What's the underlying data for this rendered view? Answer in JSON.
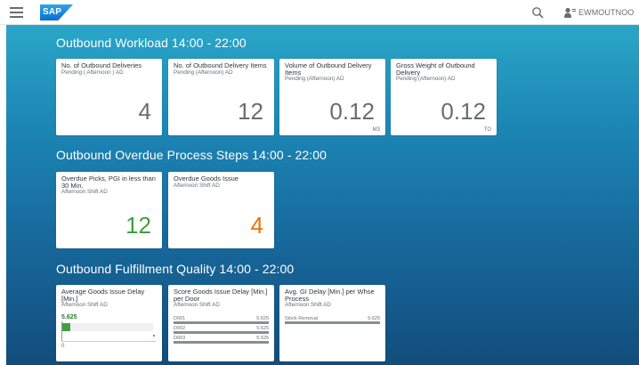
{
  "shell": {
    "logo_text": "SAP",
    "user_name": "EWMOUTNOO",
    "icons": {
      "menu": "hamburger-icon",
      "search": "search-icon",
      "user": "user-icon"
    }
  },
  "groups": [
    {
      "title": "Outbound Workload 14:00 - 22:00",
      "tiles": [
        {
          "title": "No. of Outbound Deliveries",
          "subtitle": "Pending ( Afternoon ) AD",
          "value": "4",
          "unit": ""
        },
        {
          "title": "No. of Outbound Delivery Items",
          "subtitle": "Pending (Afternoon) AD",
          "value": "12",
          "unit": ""
        },
        {
          "title": "Volume of Outbound Delivery Items",
          "subtitle": "Pending (Afternoon) AD",
          "value": "0.12",
          "unit": "M3"
        },
        {
          "title": "Gross Weight of Outbound Delivery",
          "subtitle": "Pending (Afternoon) AD",
          "value": "0.12",
          "unit": "TO"
        }
      ]
    },
    {
      "title": "Outbound Overdue Process Steps 14:00 - 22:00",
      "tiles": [
        {
          "title": "Overdue Picks, PGI in less than 30 Min.",
          "subtitle": "Afternoon Shift AD",
          "value": "12",
          "color": "#3fa03f"
        },
        {
          "title": "Overdue Goods Issue",
          "subtitle": "Afternoon Shift AD",
          "value": "4",
          "color": "#e9730c"
        }
      ]
    },
    {
      "title": "Outbound Fulfillment Quality 14:00 - 22:00",
      "tiles": [
        {
          "title": "Average Goods Issue Delay [Min.]",
          "subtitle": "Afternoon Shift AD",
          "value": "5.625",
          "axis_min": "0",
          "bar_fraction": 0.1
        },
        {
          "title": "Score Goods Issue Delay [Min.] per Door",
          "subtitle": "Afternoon Shift AD",
          "rows": [
            {
              "label": "D001",
              "value": "5.625"
            },
            {
              "label": "D002",
              "value": "5.625"
            },
            {
              "label": "D003",
              "value": "5.625"
            }
          ]
        },
        {
          "title": "Avg. GI Delay [Min.] per Whse Process",
          "subtitle": "Afternoon Shift AD",
          "rows": [
            {
              "label": "Stock Removal",
              "value": "5.625"
            }
          ]
        }
      ]
    }
  ],
  "colors": {
    "accent": "#0a6ed1",
    "background_top": "#2aa6c8",
    "background_bottom": "#124d7c",
    "positive": "#3fa03f",
    "critical": "#e9730c"
  }
}
